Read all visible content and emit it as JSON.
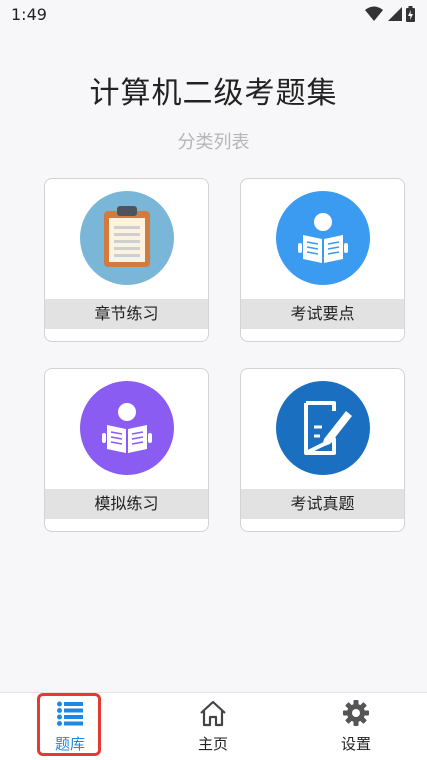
{
  "status_bar": {
    "time": "1:49"
  },
  "header": {
    "title": "计算机二级考题集",
    "subtitle": "分类列表"
  },
  "cards": [
    {
      "label": "章节练习",
      "icon": "clipboard-icon",
      "color": "#79b6d8"
    },
    {
      "label": "考试要点",
      "icon": "reading-person-icon",
      "color": "#3a9bf0"
    },
    {
      "label": "模拟练习",
      "icon": "reading-person-icon",
      "color": "#8a5cf2"
    },
    {
      "label": "考试真题",
      "icon": "edit-pen-icon",
      "color": "#1a6fc0"
    }
  ],
  "bottom_nav": [
    {
      "label": "题库",
      "icon": "list-icon",
      "active": true
    },
    {
      "label": "主页",
      "icon": "home-icon",
      "active": false
    },
    {
      "label": "设置",
      "icon": "gear-icon",
      "active": false
    }
  ],
  "colors": {
    "accent": "#1e88e5",
    "highlight": "#e53935"
  }
}
